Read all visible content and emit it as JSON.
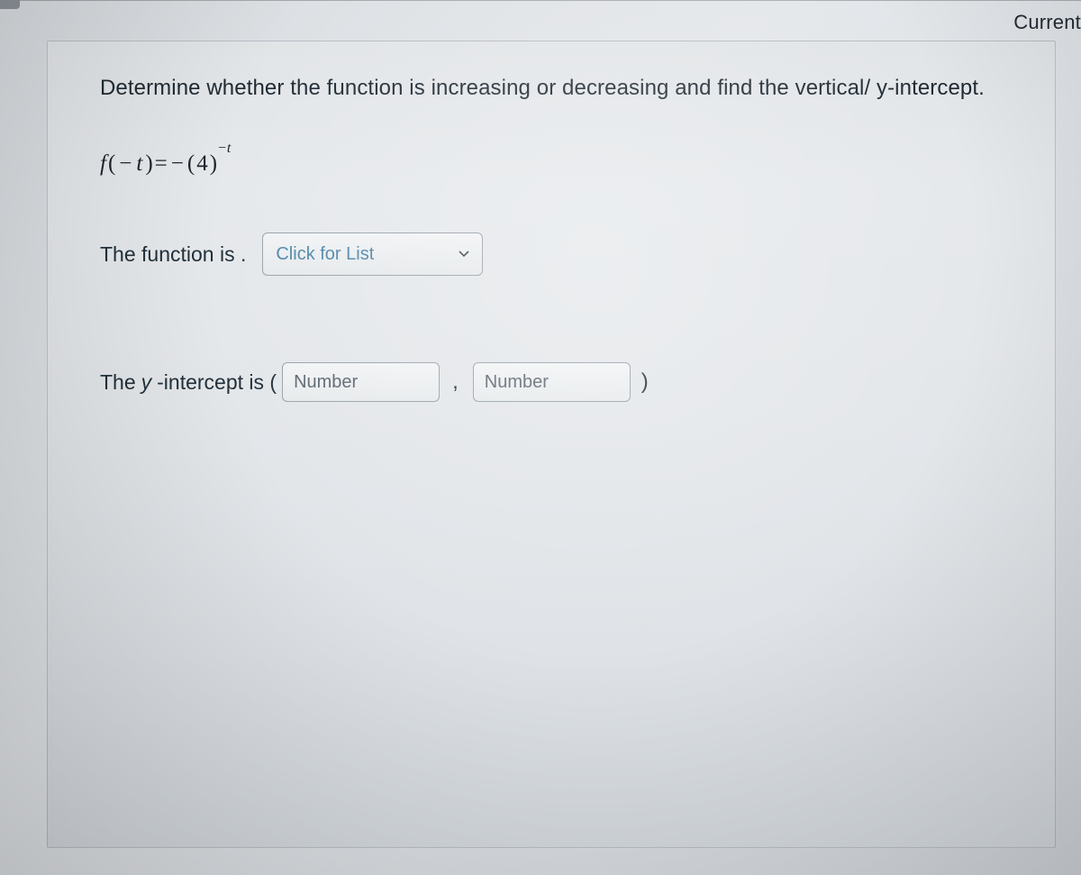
{
  "header": {
    "top_right": "Current"
  },
  "question": {
    "prompt": "Determine whether the function is increasing or decreasing and find the vertical/ y-intercept.",
    "formula": {
      "fn": "f",
      "lpar": "(",
      "neg": "−",
      "var": "t",
      "rpar": ")",
      "eq": " = ",
      "neg2": "−",
      "base_l": "(",
      "base": "4",
      "base_r": ")",
      "exp_neg": "−",
      "exp_var": "t"
    }
  },
  "row1": {
    "prefix": "The function is .",
    "dropdown_placeholder": "Click for List"
  },
  "row2": {
    "prefix_a": "The ",
    "prefix_y": "y",
    "prefix_b": "-intercept is (",
    "input1_placeholder": "Number",
    "comma": ",",
    "input2_placeholder": "Number",
    "suffix": ")"
  }
}
